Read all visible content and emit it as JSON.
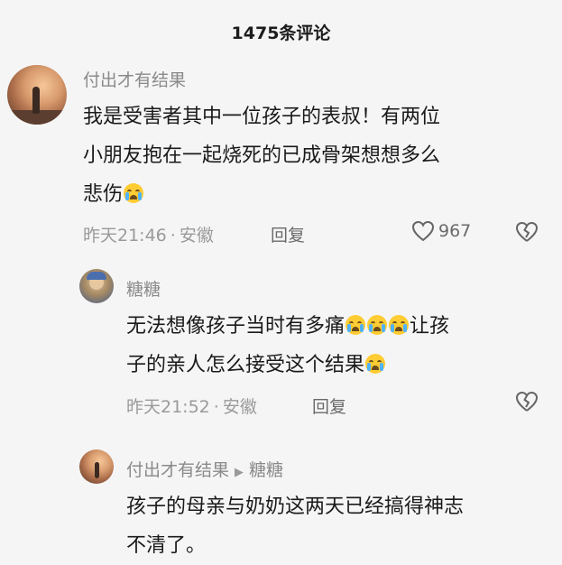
{
  "header": {
    "title": "1475条评论"
  },
  "comments": [
    {
      "username": "付出才有结果",
      "text_line1": "我是受害者其中一位孩子的表叔！有两位",
      "text_line2": "小朋友抱在一起烧死的已成骨架想想多么",
      "text_line3": "悲伤",
      "time": "昨天21:46",
      "dot": "·",
      "location": "安徽",
      "reply_label": "回复",
      "likes": "967"
    },
    {
      "username": "糖糖",
      "text_line1": "无法想像孩子当时有多痛",
      "text_line1b": "让孩",
      "text_line2": "子的亲人怎么接受这个结果",
      "time": "昨天21:52",
      "dot": "·",
      "location": "安徽",
      "reply_label": "回复"
    },
    {
      "username": "付出才有结果",
      "reply_to": "糖糖",
      "text_line1": "孩子的母亲与奶奶这两天已经搞得神志",
      "text_line2": "不清了。"
    }
  ],
  "icons": {
    "crying_emoji": "crying-face-icon",
    "heart": "heart-icon",
    "broken_heart": "broken-heart-icon",
    "reply_arrow": "triangle-right-icon"
  }
}
